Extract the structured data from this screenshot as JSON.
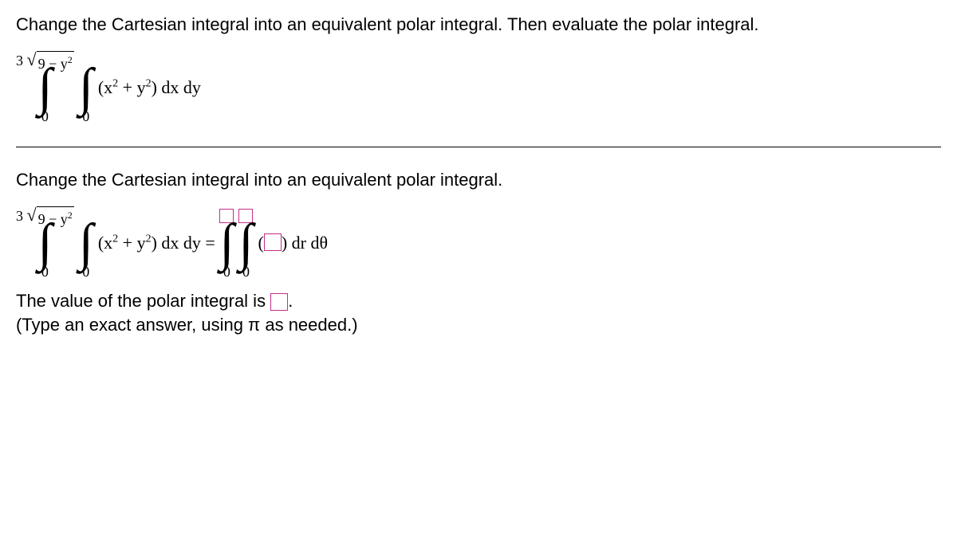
{
  "q": {
    "prompt": "Change the Cartesian integral into an equivalent polar integral. Then evaluate the polar integral.",
    "integral": {
      "outer": {
        "lower": "0",
        "upper_pre": "3",
        "upper_rad": "9 − y",
        "upper_rad_exp": "2"
      },
      "inner": {
        "lower": "0",
        "upper": ""
      },
      "integrand_a": "x",
      "integrand_b": " + y",
      "measure": " dx dy"
    }
  },
  "a": {
    "subprompt": "Change the Cartesian integral into an equivalent polar integral.",
    "lhs": {
      "outer": {
        "lower": "0",
        "upper_pre": "3",
        "upper_rad": "9 − y",
        "upper_rad_exp": "2"
      },
      "inner": {
        "lower": "0"
      },
      "integrand_a": "x",
      "integrand_b": " + y",
      "measure": " dx dy ="
    },
    "rhs": {
      "outer": {
        "lower": "0"
      },
      "inner": {
        "lower": "0"
      },
      "measure": " dr dθ"
    },
    "value_pre": "The value of the polar integral is ",
    "value_post": ".",
    "hint": "(Type an exact answer, using π as needed.)"
  }
}
